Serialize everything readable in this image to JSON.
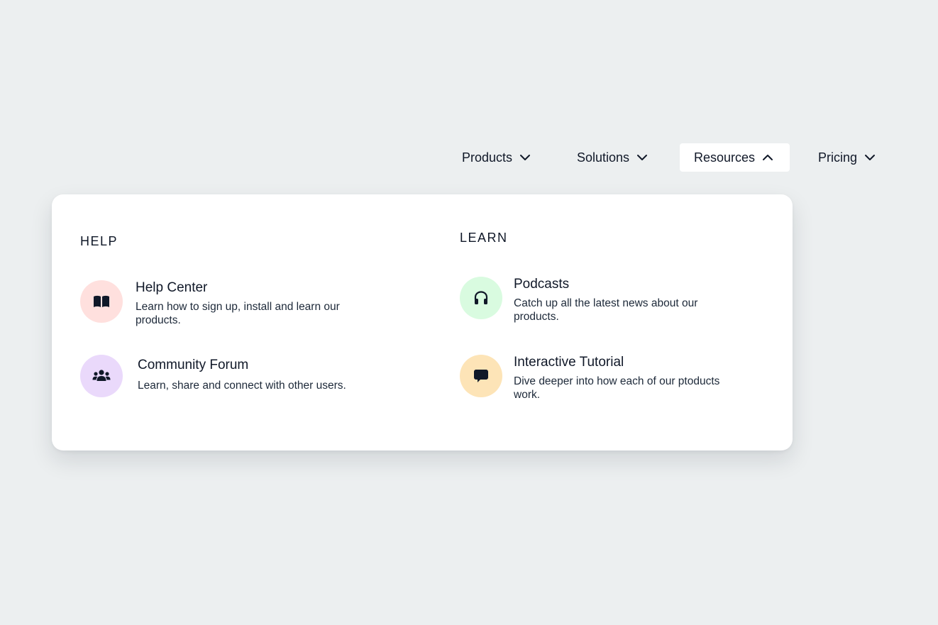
{
  "colors": {
    "background": "#eceff0",
    "panel": "#ffffff",
    "text": "#101828",
    "help_center_icon_bg": "#ffe0de",
    "community_icon_bg": "#ead9fb",
    "podcasts_icon_bg": "#d9fbe0",
    "tutorial_icon_bg": "#fde4b7"
  },
  "nav": {
    "items": [
      {
        "label": "Products",
        "icon": "chevron-down-icon",
        "expanded": false
      },
      {
        "label": "Solutions",
        "icon": "chevron-down-icon",
        "expanded": false
      },
      {
        "label": "Resources",
        "icon": "chevron-up-icon",
        "expanded": true
      },
      {
        "label": "Pricing",
        "icon": "chevron-down-icon",
        "expanded": false
      }
    ]
  },
  "dropdown": {
    "help": {
      "heading": "HELP",
      "items": [
        {
          "title": "Help Center",
          "description": "Learn how to sign up, install and learn our products.",
          "icon": "book-icon"
        },
        {
          "title": "Community Forum",
          "description": "Learn, share and connect with other users.",
          "icon": "users-icon"
        }
      ]
    },
    "learn": {
      "heading": "LEARN",
      "items": [
        {
          "title": "Podcasts",
          "description": "Catch up all the latest news about our products.",
          "icon": "headphones-icon"
        },
        {
          "title": "Interactive Tutorial",
          "description": "Dive deeper into how each of our ptoducts work.",
          "icon": "chat-bubble-icon"
        }
      ]
    }
  }
}
